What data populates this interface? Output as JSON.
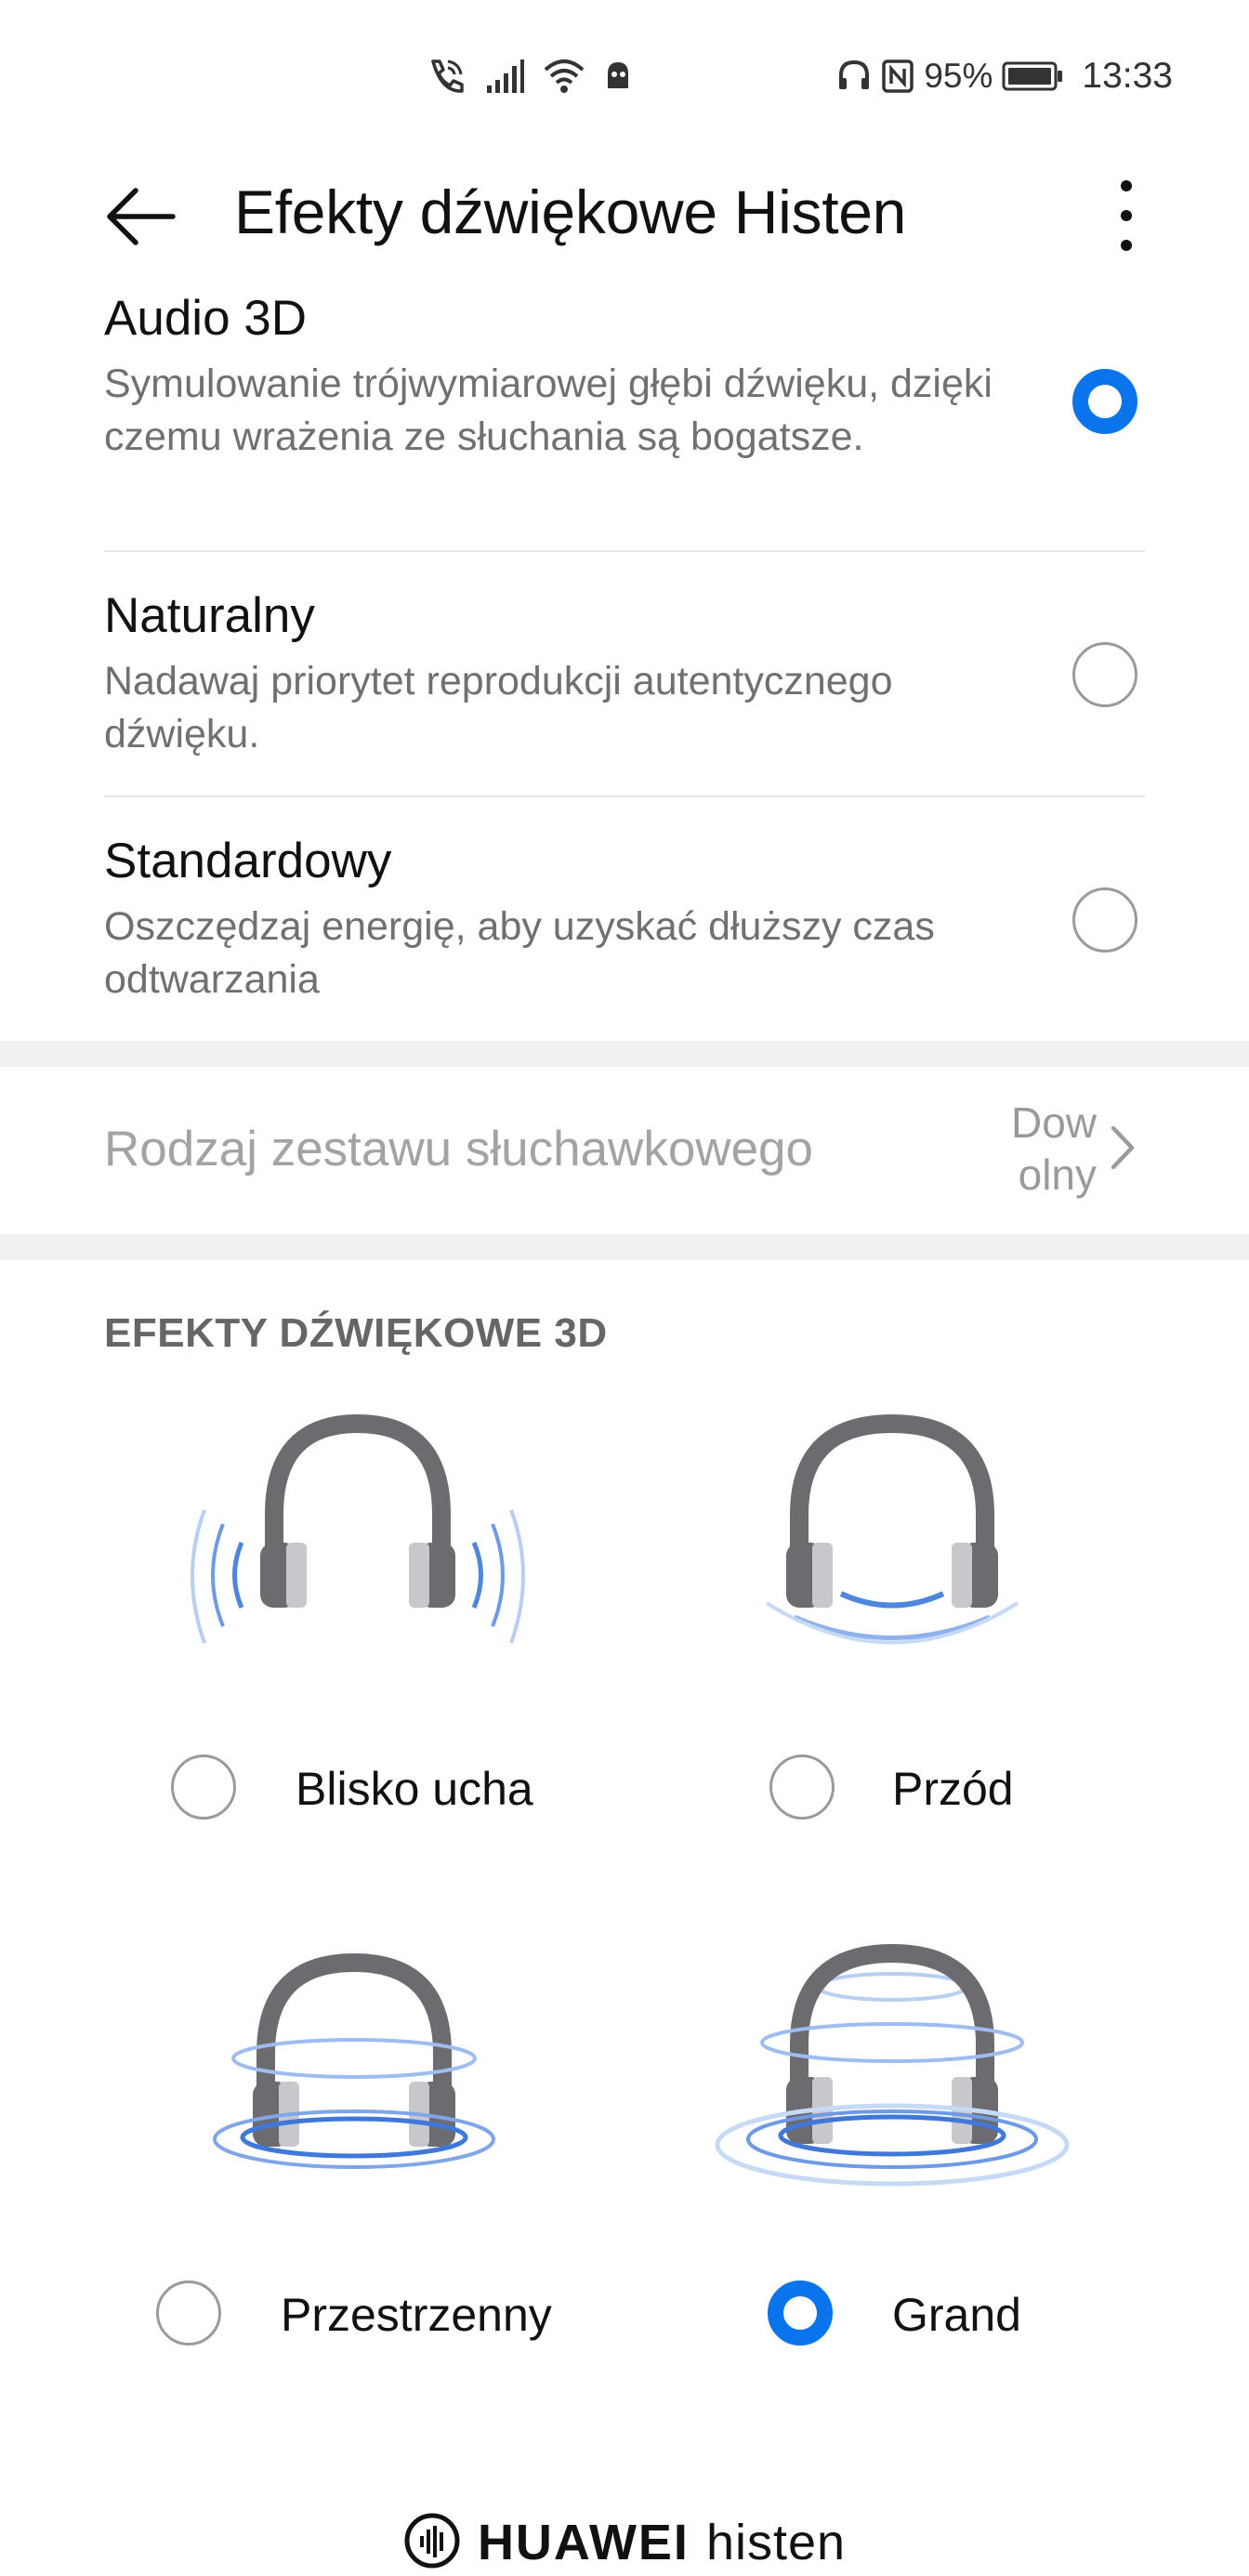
{
  "status_bar": {
    "battery_percent": "95%",
    "time": "13:33",
    "icons": [
      "wifi-calling-icon",
      "signal-icon",
      "wifi-icon",
      "app-notification-icon",
      "headset-icon",
      "nfc-icon",
      "battery-icon"
    ]
  },
  "app_bar": {
    "title": "Efekty dźwiękowe Histen",
    "back_icon": "arrow-back-icon",
    "more_icon": "more-vertical-icon"
  },
  "modes": [
    {
      "title": "Audio 3D",
      "description": "Symulowanie trójwymiarowej głębi dźwięku, dzięki czemu wrażenia ze słuchania są bogatsze.",
      "selected": true
    },
    {
      "title": "Naturalny",
      "description": "Nadawaj priorytet reprodukcji autentycznego dźwięku.",
      "selected": false
    },
    {
      "title": "Standardowy",
      "description": "Oszczędzaj energię, aby uzyskać dłuższy czas odtwarzania",
      "selected": false
    }
  ],
  "headset_type": {
    "label": "Rodzaj zestawu słuchawkowego",
    "value_line1": "Dow",
    "value_line2": "olny"
  },
  "effects_section": {
    "title": "EFEKTY DŹWIĘKOWE 3D",
    "items": [
      {
        "label": "Blisko ucha",
        "selected": false
      },
      {
        "label": "Przód",
        "selected": false
      },
      {
        "label": "Przestrzenny",
        "selected": false
      },
      {
        "label": "Grand",
        "selected": true
      }
    ]
  },
  "brand": {
    "name": "HUAWEI",
    "product": "histen"
  },
  "colors": {
    "accent": "#0a74ed",
    "wave_blue": "#5a93e6",
    "headphone_gray": "#6b6b70"
  }
}
